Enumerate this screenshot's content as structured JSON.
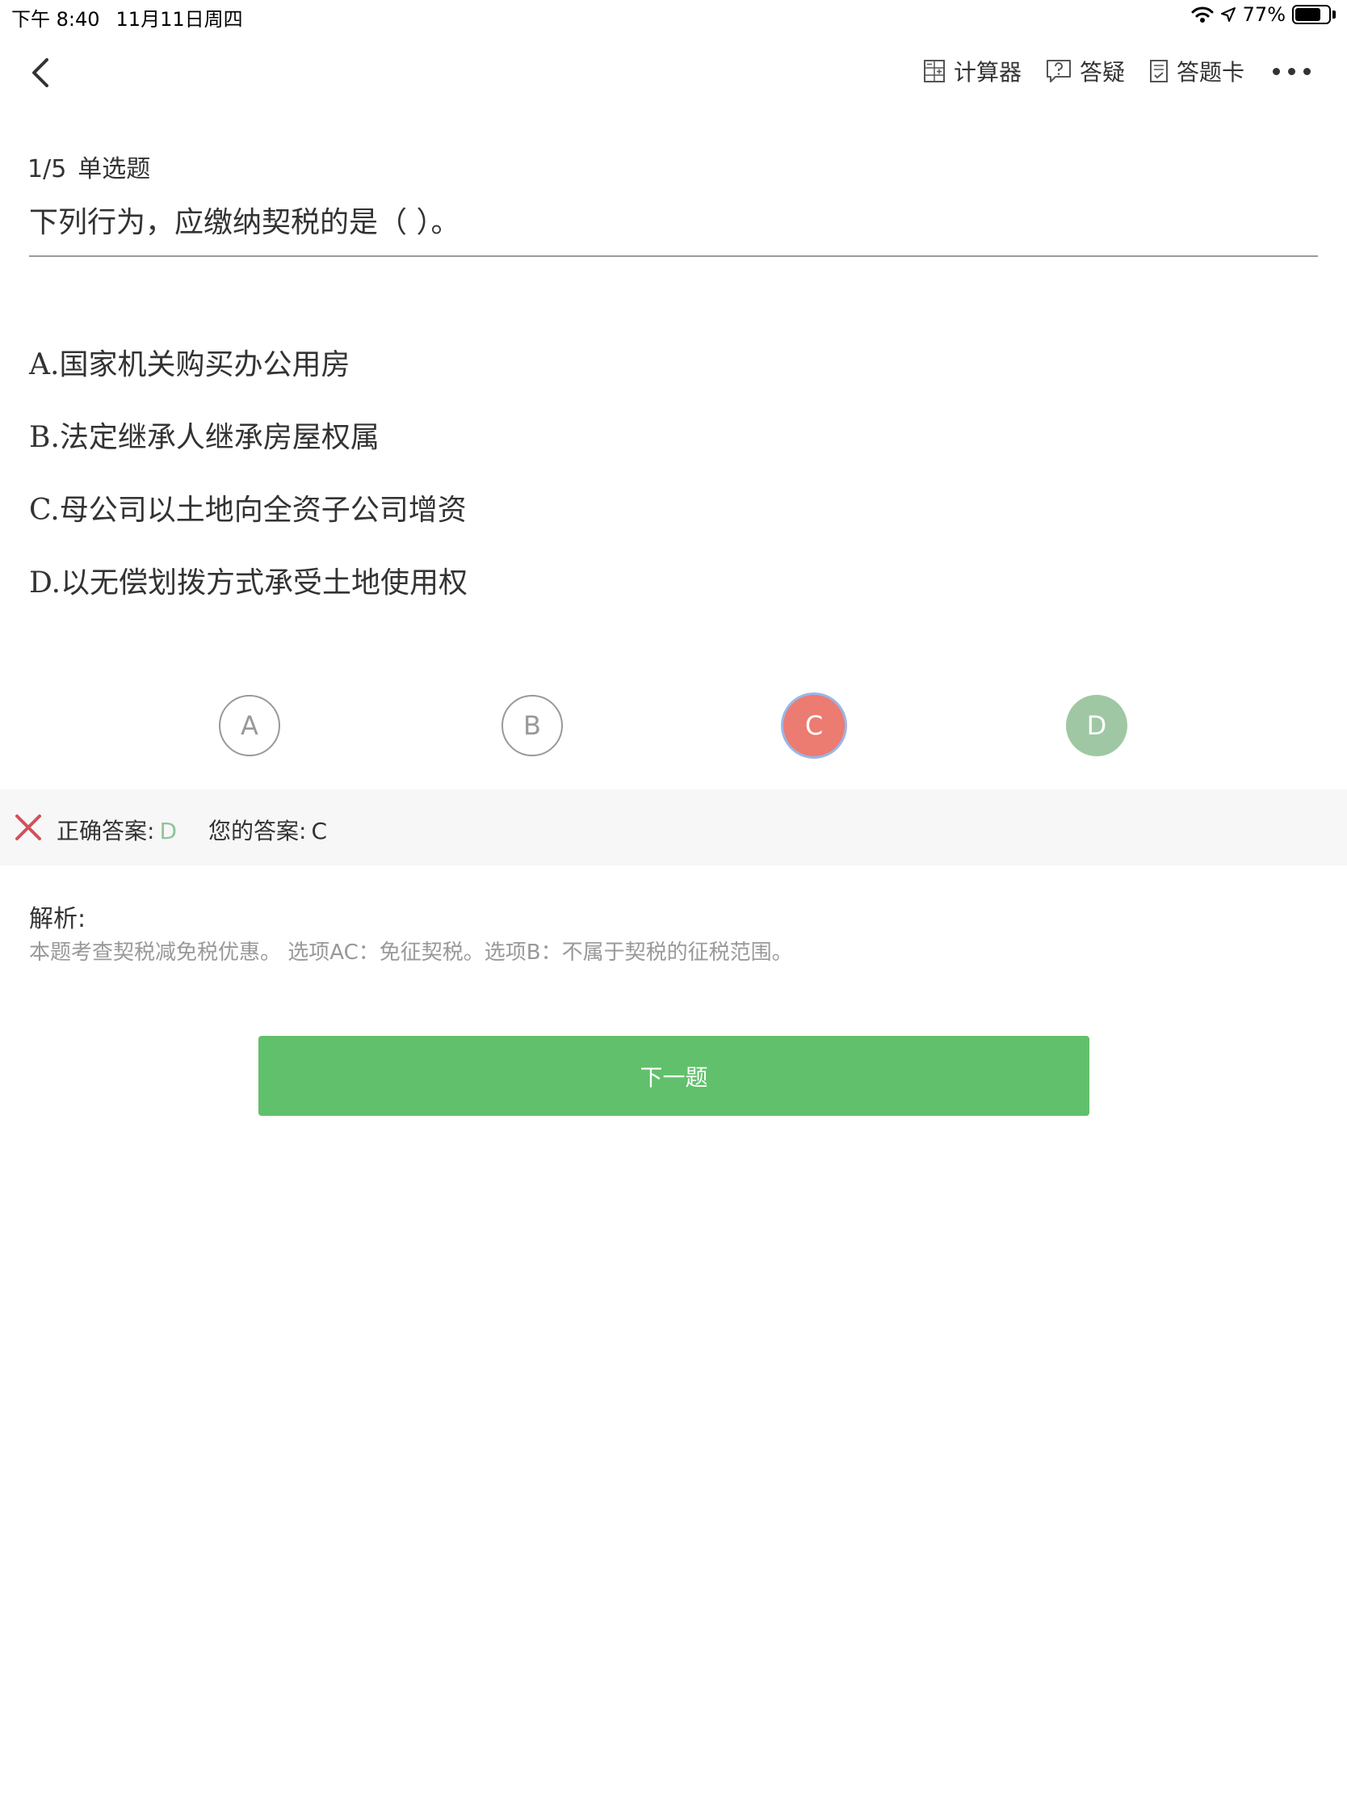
{
  "status_bar": {
    "time": "下午 8:40",
    "date": "11月11日周四",
    "battery_text": "77%",
    "battery_level": 0.77,
    "icons": [
      "wifi-icon",
      "location-arrow-icon",
      "battery-icon"
    ]
  },
  "nav": {
    "back_icon": "chevron-left-icon",
    "tools": [
      {
        "icon": "calculator-icon",
        "label": "计算器"
      },
      {
        "icon": "question-bubble-icon",
        "label": "答疑"
      },
      {
        "icon": "answer-sheet-icon",
        "label": "答题卡"
      }
    ],
    "more_icon": "more-dots-icon"
  },
  "question": {
    "progress": "1/5",
    "type": "单选题",
    "stem": "下列行为，应缴纳契税的是（ ）。",
    "options": [
      {
        "key": "A.",
        "text": "国家机关购买办公用房"
      },
      {
        "key": "B.",
        "text": "法定继承人继承房屋权属"
      },
      {
        "key": "C.",
        "text": "母公司以土地向全资子公司增资"
      },
      {
        "key": "D.",
        "text": "以无偿划拨方式承受土地使用权"
      }
    ]
  },
  "choices": [
    {
      "label": "A",
      "state": "unselected"
    },
    {
      "label": "B",
      "state": "unselected"
    },
    {
      "label": "C",
      "state": "selected-wrong"
    },
    {
      "label": "D",
      "state": "correct"
    }
  ],
  "result": {
    "icon": "wrong-x-icon",
    "correct_label": "正确答案:",
    "correct_value": "D",
    "user_label": "您的答案:",
    "user_value": "C"
  },
  "analysis": {
    "title": "解析:",
    "body": "本题考查契税减免税优惠。 选项AC：免征契税。选项B：不属于契税的征税范围。"
  },
  "next_button": "下一题",
  "colors": {
    "wrong": "#ec7b72",
    "correct": "#9fc7a3",
    "correct_text": "#8fc49a",
    "next_button": "#61c06b",
    "x_icon": "#d2505c"
  }
}
